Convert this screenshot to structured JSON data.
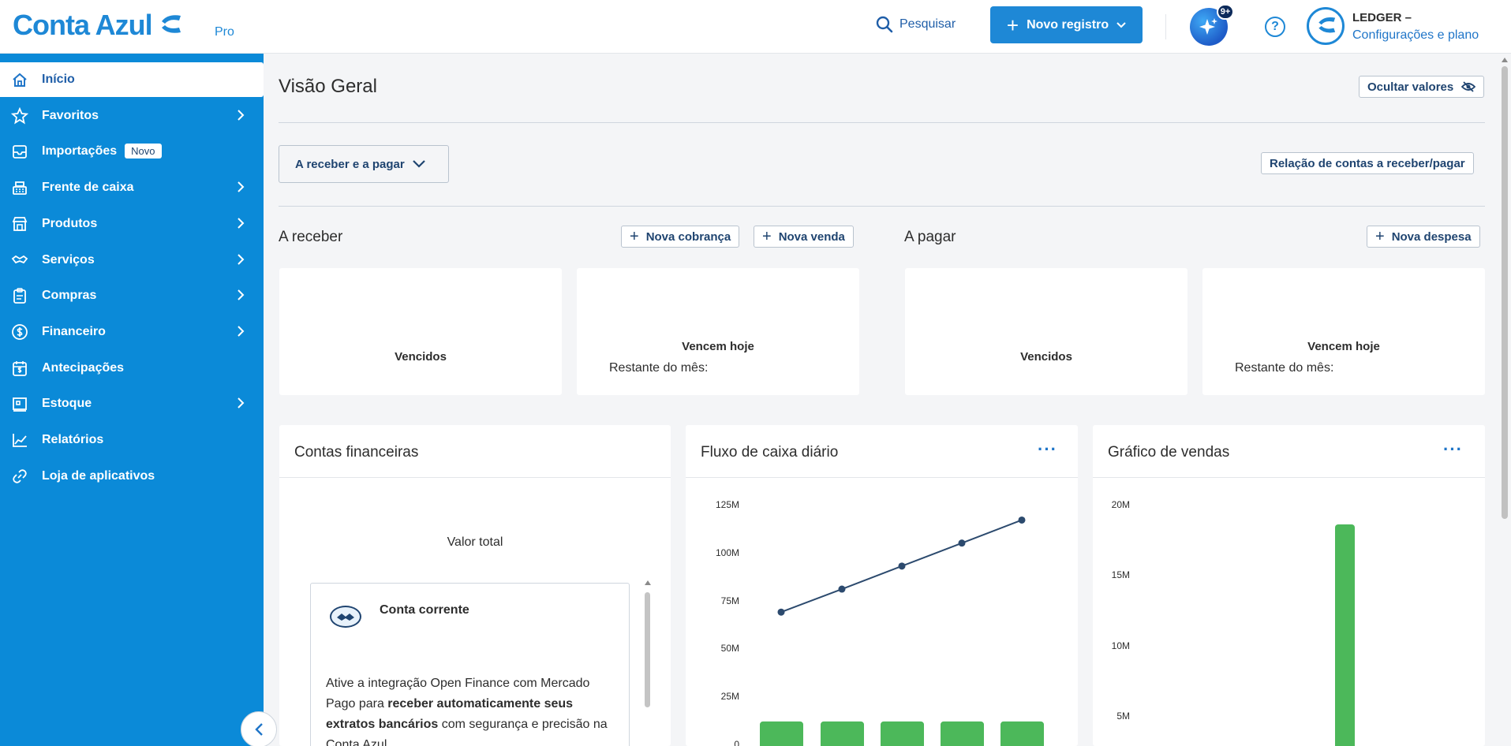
{
  "app": {
    "logo_text": "Conta Azul",
    "logo_plan": "Pro",
    "brand_color": "#1e88d6",
    "sidebar_color": "#0b8ad8"
  },
  "header": {
    "search_label": "Pesquisar",
    "new_record_label": "Novo registro",
    "ai_badge": "9+",
    "help_label": "?",
    "account_name": "LEDGER –",
    "account_link": "Configurações e plano"
  },
  "sidebar": {
    "items": [
      {
        "label": "Início",
        "icon": "home-icon",
        "active": true,
        "arrow": false
      },
      {
        "label": "Favoritos",
        "icon": "star-icon",
        "arrow": true
      },
      {
        "label": "Importações",
        "icon": "inbox-icon",
        "badge": "Novo",
        "arrow": false
      },
      {
        "label": "Frente de caixa",
        "icon": "cash-register-icon",
        "arrow": true
      },
      {
        "label": "Produtos",
        "icon": "store-icon",
        "arrow": true
      },
      {
        "label": "Serviços",
        "icon": "handshake-icon",
        "arrow": true
      },
      {
        "label": "Compras",
        "icon": "clipboard-icon",
        "arrow": true
      },
      {
        "label": "Financeiro",
        "icon": "dollar-circle-icon",
        "arrow": true
      },
      {
        "label": "Antecipações",
        "icon": "calendar-dollar-icon",
        "arrow": false
      },
      {
        "label": "Estoque",
        "icon": "inventory-icon",
        "arrow": true
      },
      {
        "label": "Relatórios",
        "icon": "chart-line-icon",
        "arrow": false
      },
      {
        "label": "Loja de aplicativos",
        "icon": "link-icon",
        "arrow": false
      }
    ]
  },
  "main": {
    "title": "Visão Geral",
    "hide_values_label": "Ocultar valores",
    "filter_label": "A receber e a pagar",
    "relation_label": "Relação de contas a receber/pagar",
    "receivable": {
      "title": "A receber",
      "new_charge_label": "Nova cobrança",
      "new_sale_label": "Nova venda",
      "overdue_label": "Vencidos",
      "due_today_label": "Vencem hoje",
      "rest_of_month_label": "Restante do mês:"
    },
    "payable": {
      "title": "A pagar",
      "new_expense_label": "Nova despesa",
      "overdue_label": "Vencidos",
      "due_today_label": "Vencem hoje",
      "rest_of_month_label": "Restante do mês:"
    }
  },
  "panels": {
    "accounts": {
      "title": "Contas financeiras",
      "total_label": "Valor total",
      "account_title": "Conta corrente",
      "text_1": "Ative a integração Open Finance com Mercado Pago para ",
      "text_bold_1": "receber automaticamente seus extratos bancários",
      "text_2": " com segurança e precisão na Conta Azul."
    },
    "cashflow": {
      "title": "Fluxo de caixa diário",
      "more": "···"
    },
    "sales": {
      "title": "Gráfico de vendas",
      "more": "···"
    }
  },
  "chart_data": [
    {
      "type": "bar+line",
      "title": "Fluxo de caixa diário",
      "y_ticks": [
        "0",
        "25M",
        "50M",
        "75M",
        "100M",
        "125M"
      ],
      "ylim": [
        0,
        125
      ],
      "line_values": [
        69,
        81,
        93,
        105,
        117
      ],
      "bar_values": [
        12,
        12,
        12,
        12,
        12
      ],
      "line_color": "#2c4a6e",
      "bar_color": "#4cb85a"
    },
    {
      "type": "bar",
      "title": "Gráfico de vendas",
      "y_ticks": [
        "5M",
        "10M",
        "15M",
        "20M"
      ],
      "ylim": [
        0,
        20
      ],
      "bar_values": [
        18.6
      ],
      "bar_color": "#4cb85a"
    }
  ]
}
